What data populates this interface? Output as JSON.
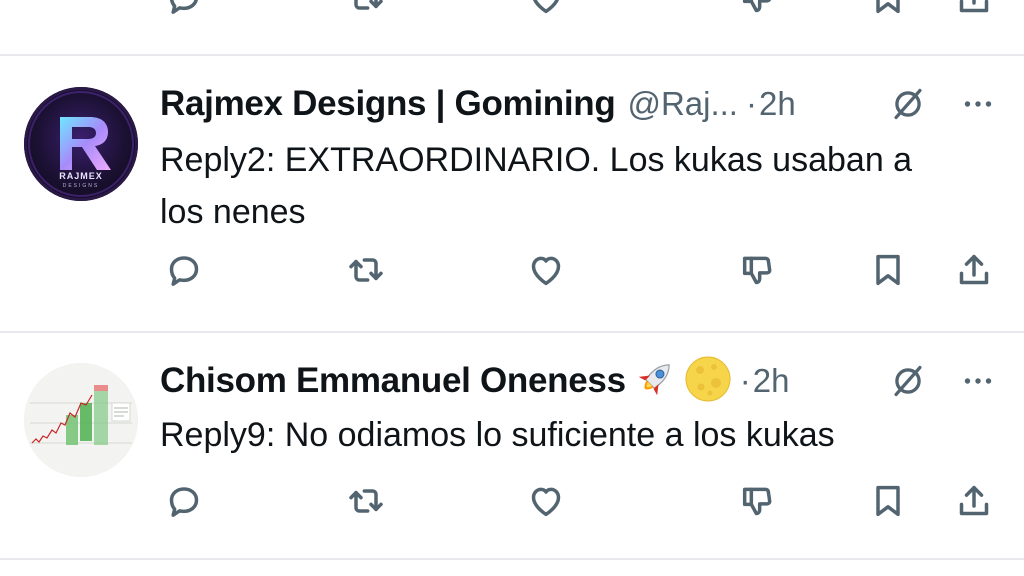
{
  "tweets": [
    {
      "display_name": "Rajmex Designs | Gomining",
      "handle": "@Raj...",
      "separator": "·",
      "time": "2h",
      "text_line1": "Reply2: EXTRAORDINARIO. Los kukas usaban a",
      "text_line2": "los nenes",
      "avatar_text": "RAJMEX",
      "avatar_subtext": "DESIGNS",
      "avatar_letter": "R"
    },
    {
      "display_name": "Chisom Emmanuel Oneness",
      "handle": "",
      "separator": "·",
      "time": "2h",
      "text_line1": "Reply9: No odiamos lo suficiente a los kukas",
      "emojis": [
        "rocket",
        "full-moon"
      ]
    }
  ],
  "icons": {
    "reply": "reply-icon",
    "retweet": "retweet-icon",
    "like": "heart-icon",
    "dislike": "thumbs-down-icon",
    "bookmark": "bookmark-icon",
    "share": "share-icon",
    "grok": "grok-icon",
    "more": "more-dots-icon"
  },
  "colors": {
    "text": "#0f1419",
    "secondary": "#536471",
    "divider": "#e7e9ec",
    "avatar1_bg": "#141022",
    "avatar1_accent": "#8b5cf6",
    "avatar2_bg": "#eef0ec"
  }
}
